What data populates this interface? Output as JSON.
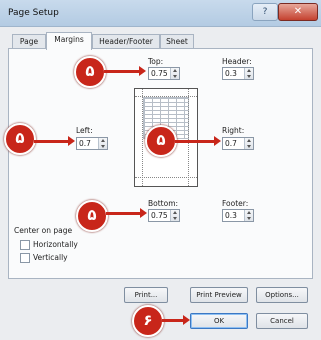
{
  "window": {
    "title": "Page Setup",
    "help_glyph": "?",
    "close_glyph": "✕"
  },
  "tabs": [
    {
      "label": "Page"
    },
    {
      "label": "Margins"
    },
    {
      "label": "Header/Footer"
    },
    {
      "label": "Sheet"
    }
  ],
  "margins": {
    "top": {
      "label": "Top:",
      "value": "0.75"
    },
    "header": {
      "label": "Header:",
      "value": "0.3"
    },
    "left": {
      "label": "Left:",
      "value": "0.7"
    },
    "right": {
      "label": "Right:",
      "value": "0.7"
    },
    "bottom": {
      "label": "Bottom:",
      "value": "0.75"
    },
    "footer": {
      "label": "Footer:",
      "value": "0.3"
    }
  },
  "center_on_page": {
    "heading": "Center on page",
    "horizontally": "Horizontally",
    "vertically": "Vertically"
  },
  "buttons": {
    "print": "Print...",
    "print_preview": "Print Preview",
    "options": "Options...",
    "ok": "OK",
    "cancel": "Cancel"
  },
  "callouts": {
    "step5": "۵",
    "step6": "۶"
  },
  "colors": {
    "callout": "#c8261a",
    "titlebar": "#b3cbe3"
  }
}
